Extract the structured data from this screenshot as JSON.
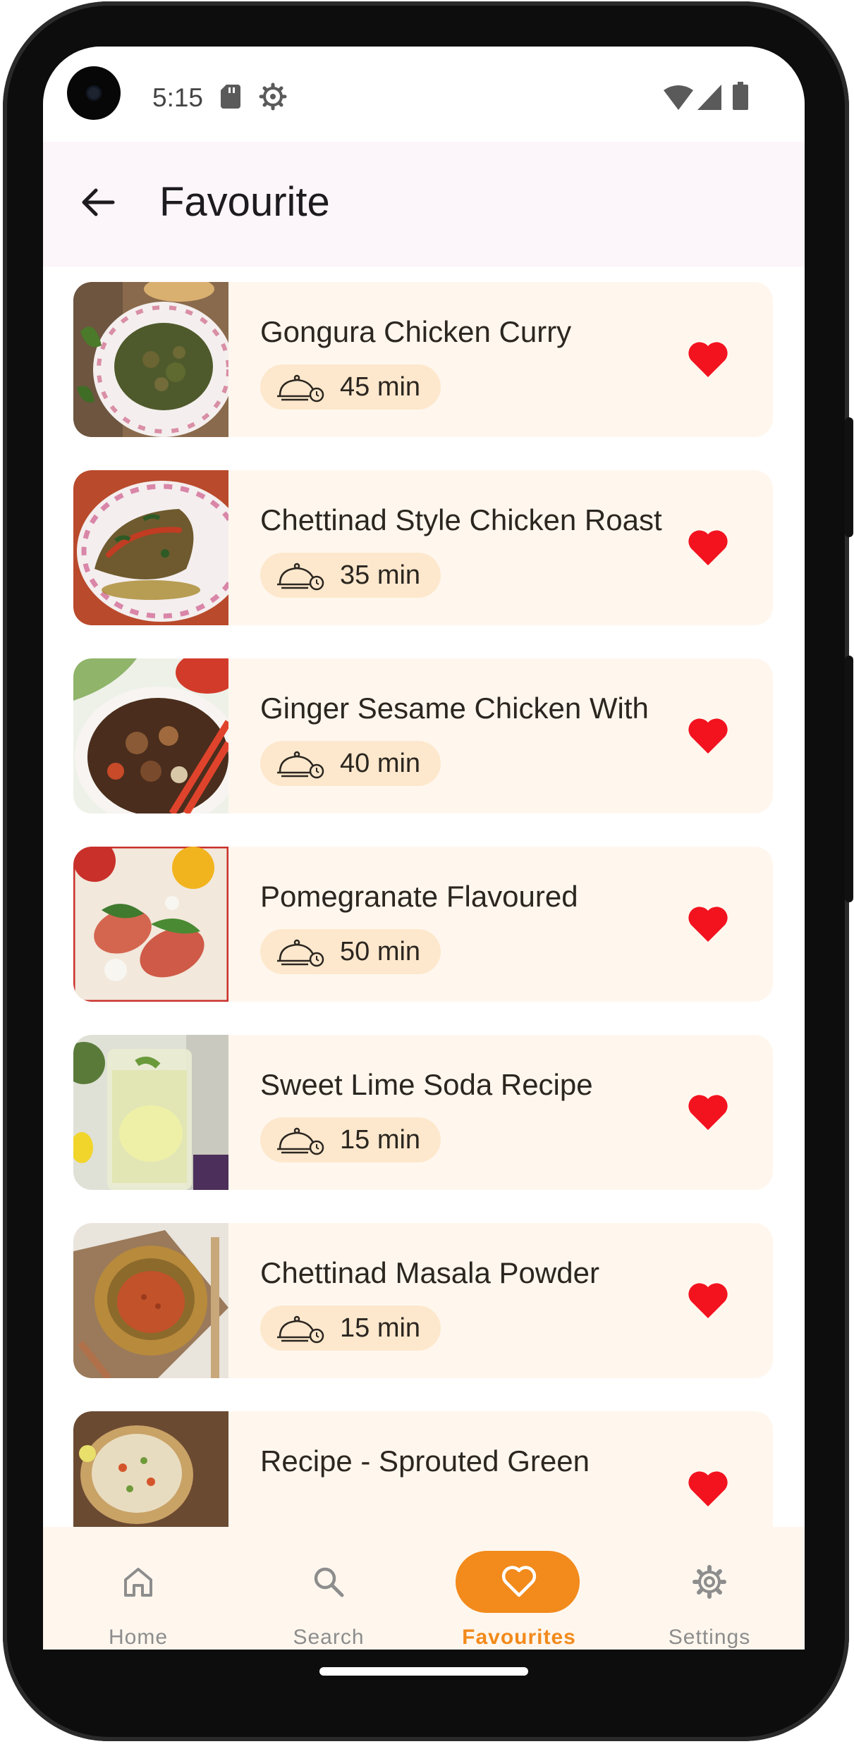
{
  "status_bar": {
    "time": "5:15"
  },
  "app_bar": {
    "title": "Favourite"
  },
  "favourites": [
    {
      "title": "Gongura Chicken Curry",
      "time": "45 min"
    },
    {
      "title": "Chettinad Style Chicken Roast",
      "time": "35 min"
    },
    {
      "title": "Ginger Sesame Chicken With",
      "time": "40 min"
    },
    {
      "title": "Pomegranate Flavoured",
      "time": "50 min"
    },
    {
      "title": "Sweet Lime Soda Recipe",
      "time": "15 min"
    },
    {
      "title": "Chettinad Masala Powder",
      "time": "15 min"
    },
    {
      "title": "Recipe - Sprouted Green",
      "time": ""
    }
  ],
  "bottom_nav": {
    "items": [
      {
        "label": "Home",
        "icon": "home-icon"
      },
      {
        "label": "Search",
        "icon": "search-icon"
      },
      {
        "label": "Favourites",
        "icon": "heart-icon",
        "active": true
      },
      {
        "label": "Settings",
        "icon": "gear-icon"
      }
    ]
  },
  "colors": {
    "accent": "#f28a1c",
    "heart": "#f2131f",
    "card": "#fff7ee",
    "chip": "#fde8cd"
  }
}
